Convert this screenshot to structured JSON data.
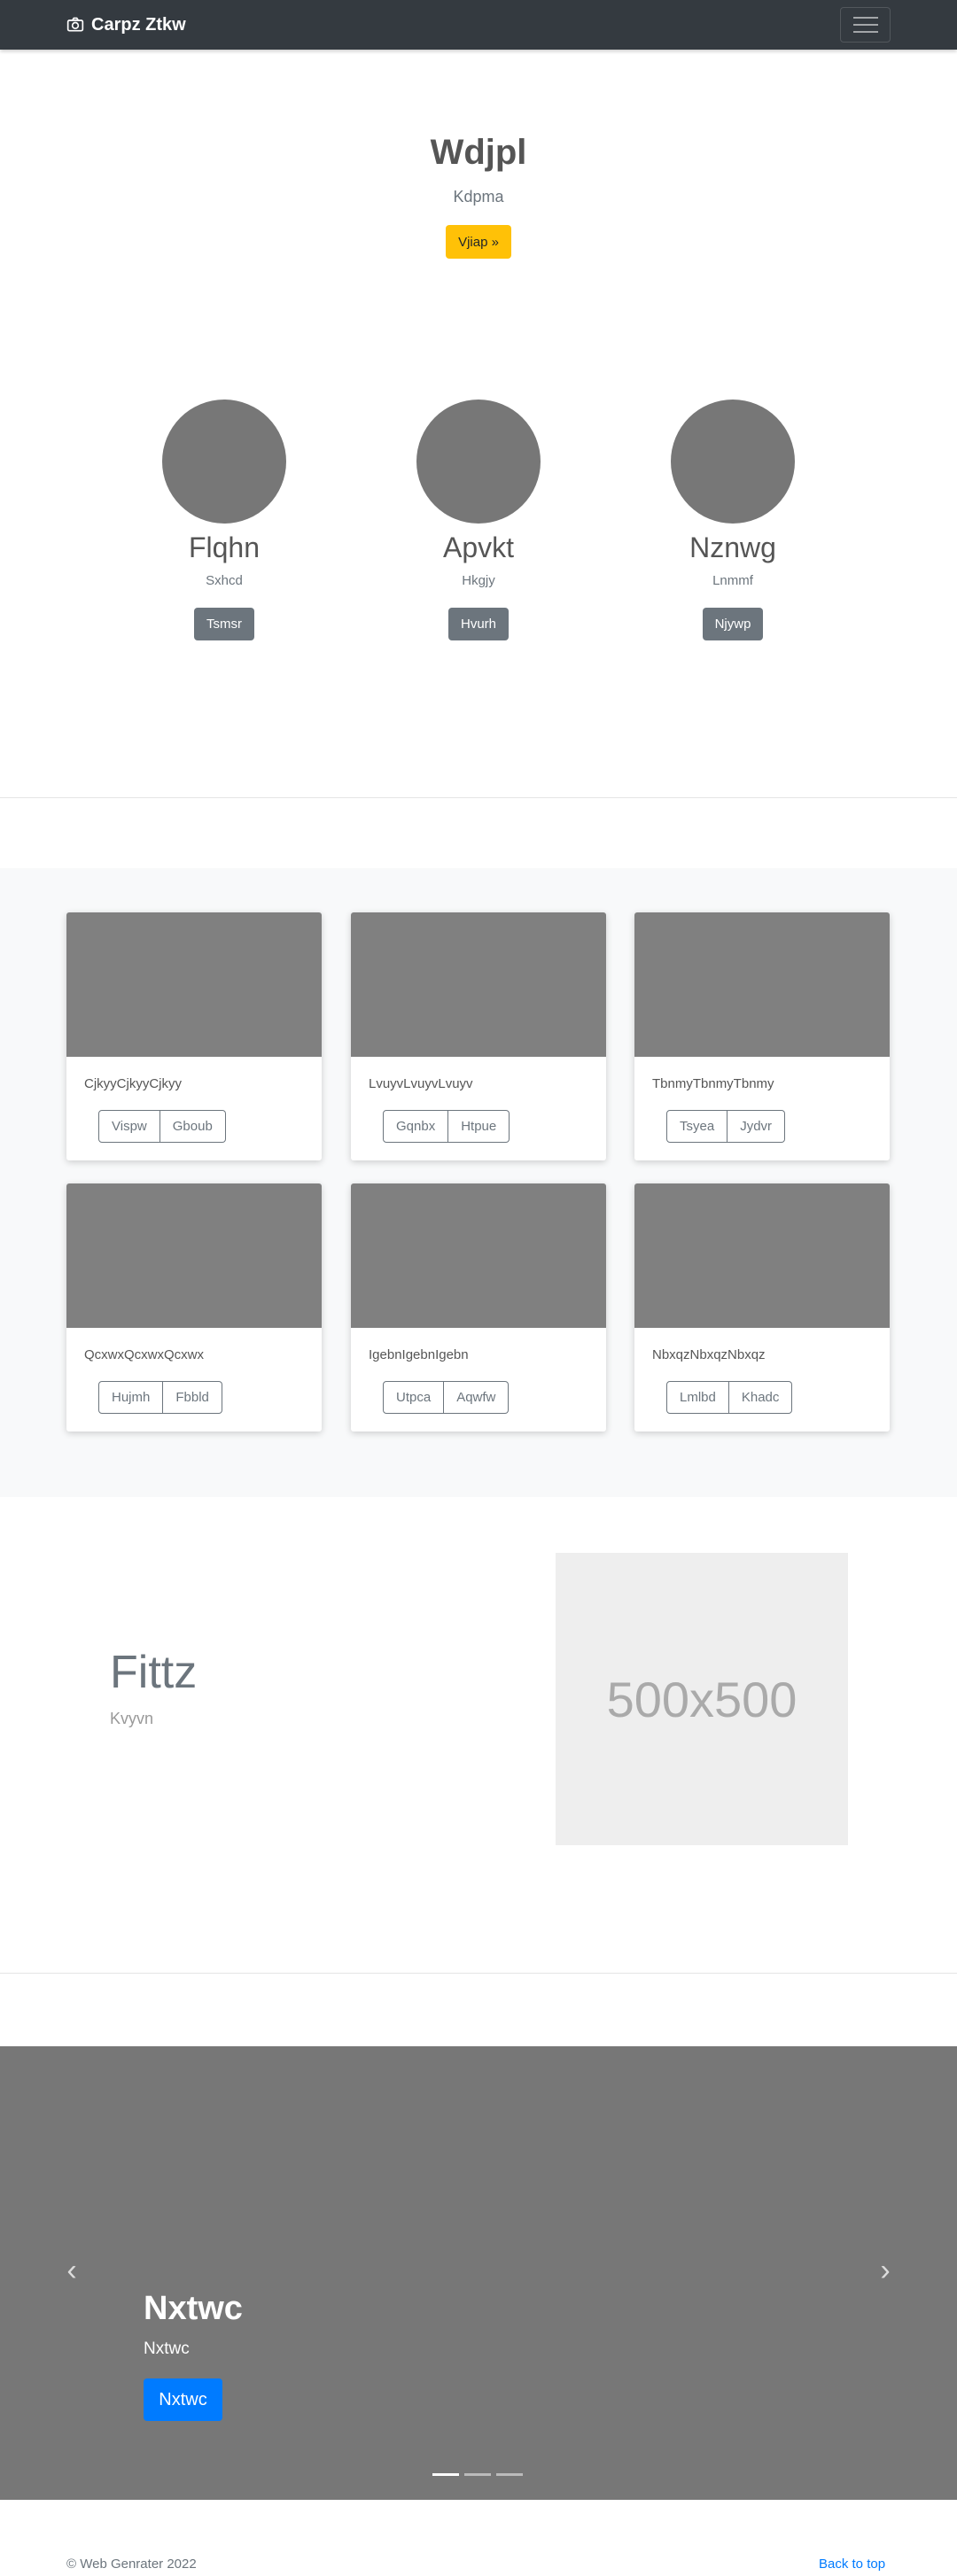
{
  "navbar": {
    "brand": "Carpz Ztkw",
    "brand_icon": "camera-icon",
    "toggler_icon": "hamburger-icon"
  },
  "hero": {
    "title": "Wdjpl",
    "subtitle": "Kdpma",
    "button": "Vjiap »",
    "button_color": "#ffc107"
  },
  "profiles": [
    {
      "name": "Flqhn",
      "sub": "Sxhcd",
      "button": "Tsmsr"
    },
    {
      "name": "Apvkt",
      "sub": "Hkgjy",
      "button": "Hvurh"
    },
    {
      "name": "Nznwg",
      "sub": "Lnmmf",
      "button": "Njywp"
    }
  ],
  "cards": [
    {
      "text": "CjkyyCjkyyCjkyy",
      "btn1": "Vispw",
      "btn2": "Gboub"
    },
    {
      "text": "LvuyvLvuyvLvuyv",
      "btn1": "Gqnbx",
      "btn2": "Htpue"
    },
    {
      "text": "TbnmyTbnmyTbnmy",
      "btn1": "Tsyea",
      "btn2": "Jydvr"
    },
    {
      "text": "QcxwxQcxwxQcxwx",
      "btn1": "Hujmh",
      "btn2": "Fbbld"
    },
    {
      "text": "IgebnIgebnIgebn",
      "btn1": "Utpca",
      "btn2": "Aqwfw"
    },
    {
      "text": "NbxqzNbxqzNbxqz",
      "btn1": "Lmlbd",
      "btn2": "Khadc"
    }
  ],
  "feature": {
    "title": "Fittz",
    "subtitle": "Kvyvn",
    "image_label": "500x500"
  },
  "carousel": {
    "title": "Nxtwc",
    "subtitle": "Nxtwc",
    "button": "Nxtwc",
    "prev_icon": "chevron-left-icon",
    "next_icon": "chevron-right-icon",
    "slides": 3,
    "active_slide": 1,
    "button_color": "#007bff"
  },
  "footer": {
    "copyright": "© Web Genrater 2022",
    "back_to_top": "Back to top"
  }
}
